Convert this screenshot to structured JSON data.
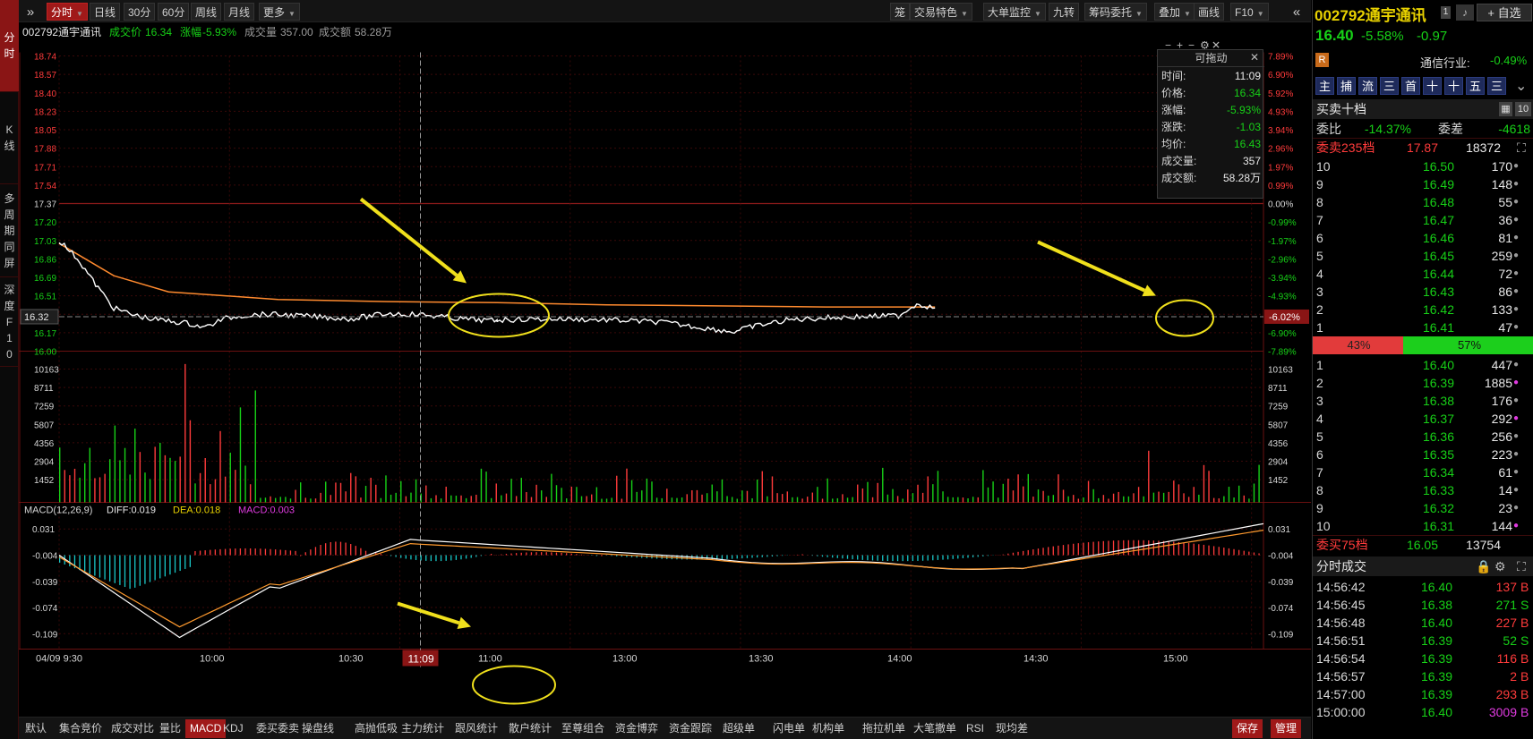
{
  "colors": {
    "up": "#ff3b3b",
    "down": "#17d117",
    "price_line": "#ffffff",
    "avg_line": "#ff8a2e",
    "accent": "#a01919",
    "annotation": "#f0e01c"
  },
  "left_tabs": [
    {
      "id": "fenshi",
      "chars": [
        "分",
        "时"
      ],
      "active": true
    },
    {
      "id": "kline",
      "chars": [
        "K",
        "线"
      ],
      "active": false
    },
    {
      "id": "multi",
      "chars": [
        "多",
        "周",
        "期",
        "同",
        "屏"
      ],
      "active": false
    },
    {
      "id": "depth",
      "chars": [
        "深",
        "度",
        "F",
        "1",
        "0"
      ],
      "active": false
    }
  ],
  "toolbar": {
    "expand_glyph": "»",
    "periods": [
      "分时",
      "日线",
      "30分",
      "60分",
      "周线",
      "月线"
    ],
    "more": "更多",
    "right": [
      "笼",
      "交易特色",
      "大单监控",
      "九转",
      "筹码委托",
      "叠加",
      "画线",
      "F10"
    ],
    "collapse_glyph": "«"
  },
  "info_bar": {
    "code_name": "002792通宇通讯",
    "price_label": "成交价",
    "price": "16.34",
    "change_label": "涨幅",
    "change": "-5.93%",
    "volume_label": "成交量",
    "volume": "357.00",
    "amount_label": "成交额",
    "amount": "58.28万"
  },
  "chart_icons": [
    "−",
    "+",
    "−",
    "⚙",
    "✕"
  ],
  "price_axis": {
    "left": [
      "18.74",
      "18.57",
      "18.40",
      "18.23",
      "18.05",
      "17.88",
      "17.71",
      "17.54",
      "17.37",
      "17.20",
      "17.03",
      "16.86",
      "16.69",
      "16.51",
      "16.34",
      "16.17",
      "16.00"
    ],
    "right": [
      "7.89%",
      "6.90%",
      "5.92%",
      "4.93%",
      "3.94%",
      "2.96%",
      "1.97%",
      "0.99%",
      "0.00%",
      "-0.99%",
      "-1.97%",
      "-2.96%",
      "-3.94%",
      "-4.93%",
      "-5.92%",
      "-6.90%",
      "-7.89%"
    ],
    "cursor_left": "16.32",
    "cursor_right": "-6.02%"
  },
  "volume_axis": [
    "10163",
    "8711",
    "7259",
    "5807",
    "4356",
    "2904",
    "1452"
  ],
  "tooltip": {
    "title": "可拖动",
    "close": "✕",
    "rows": [
      {
        "k": "时间:",
        "v": "11:09",
        "c": "white"
      },
      {
        "k": "价格:",
        "v": "16.34",
        "c": "green"
      },
      {
        "k": "涨幅:",
        "v": "-5.93%",
        "c": "green"
      },
      {
        "k": "涨跌:",
        "v": "-1.03",
        "c": "green"
      },
      {
        "k": "均价:",
        "v": "16.43",
        "c": "green"
      },
      {
        "k": "成交量:",
        "v": "357",
        "c": "white"
      },
      {
        "k": "成交额:",
        "v": "58.28万",
        "c": "white"
      }
    ]
  },
  "macd": {
    "label": "MACD(12,26,9)",
    "diff": "DIFF:0.019",
    "dea": "DEA:0.018",
    "macd": "MACD:0.003",
    "axis": [
      "0.031",
      "-0.004",
      "-0.039",
      "-0.074",
      "-0.109"
    ]
  },
  "time_axis": {
    "labels": [
      "04/09 9:30",
      "10:00",
      "10:30",
      "11:00",
      "13:00",
      "13:30",
      "14:00",
      "14:30",
      "15:00"
    ],
    "cursor": "11:09"
  },
  "bottom_tabs": [
    "默认",
    "集合竞价",
    "成交对比",
    "量比",
    "MACD",
    "KDJ",
    "委买委卖",
    "操盘线",
    "高抛低吸",
    "主力统计",
    "跟风统计",
    "散户统计",
    "至尊组合",
    "资金博弈",
    "资金跟踪",
    "超级单",
    "闪电单",
    "机构单",
    "拖拉机单",
    "大笔撤单",
    "RSI",
    "现均差"
  ],
  "bottom_right": [
    "保存",
    "管理"
  ],
  "right_panel": {
    "code": "002792",
    "name": "通宇通讯",
    "badge": "1",
    "self_select": "+ 自选",
    "price": "16.40",
    "pct": "-5.58%",
    "chg": "-0.97",
    "r_badge": "R",
    "industry": "通信行业:",
    "industry_pct": "-0.49%",
    "mini_buttons": [
      "主",
      "捕",
      "流",
      "三",
      "首",
      "十",
      "十",
      "五",
      "三"
    ],
    "book_title": "买卖十档",
    "book_size": "10",
    "ratio_label": "委比",
    "ratio": "-14.37%",
    "diff_label": "委差",
    "diff": "-4618",
    "ask_header": {
      "label": "委卖235档",
      "price": "17.87",
      "vol": "18372"
    },
    "asks": [
      {
        "n": "10",
        "p": "16.50",
        "v": "170"
      },
      {
        "n": "9",
        "p": "16.49",
        "v": "148"
      },
      {
        "n": "8",
        "p": "16.48",
        "v": "55"
      },
      {
        "n": "7",
        "p": "16.47",
        "v": "36"
      },
      {
        "n": "6",
        "p": "16.46",
        "v": "81"
      },
      {
        "n": "5",
        "p": "16.45",
        "v": "259"
      },
      {
        "n": "4",
        "p": "16.44",
        "v": "72"
      },
      {
        "n": "3",
        "p": "16.43",
        "v": "86"
      },
      {
        "n": "2",
        "p": "16.42",
        "v": "133"
      },
      {
        "n": "1",
        "p": "16.41",
        "v": "47"
      }
    ],
    "split": {
      "sell": "43%",
      "buy": "57%",
      "sell_frac": 0.43
    },
    "bids": [
      {
        "n": "1",
        "p": "16.40",
        "v": "447",
        "dot": "gray"
      },
      {
        "n": "2",
        "p": "16.39",
        "v": "1885",
        "dot": "magenta"
      },
      {
        "n": "3",
        "p": "16.38",
        "v": "176",
        "dot": "gray"
      },
      {
        "n": "4",
        "p": "16.37",
        "v": "292",
        "dot": "magenta"
      },
      {
        "n": "5",
        "p": "16.36",
        "v": "256",
        "dot": "gray"
      },
      {
        "n": "6",
        "p": "16.35",
        "v": "223",
        "dot": "gray"
      },
      {
        "n": "7",
        "p": "16.34",
        "v": "61",
        "dot": "gray"
      },
      {
        "n": "8",
        "p": "16.33",
        "v": "14",
        "dot": "gray"
      },
      {
        "n": "9",
        "p": "16.32",
        "v": "23",
        "dot": "gray"
      },
      {
        "n": "10",
        "p": "16.31",
        "v": "144",
        "dot": "magenta"
      }
    ],
    "bid_header": {
      "label": "委买75档",
      "price": "16.05",
      "vol": "13754"
    },
    "trades_title": "分时成交",
    "trades": [
      {
        "t": "14:56:42",
        "p": "16.40",
        "v": "137",
        "s": "B",
        "c": "red"
      },
      {
        "t": "14:56:45",
        "p": "16.38",
        "v": "271",
        "s": "S",
        "c": "green"
      },
      {
        "t": "14:56:48",
        "p": "16.40",
        "v": "227",
        "s": "B",
        "c": "red"
      },
      {
        "t": "14:56:51",
        "p": "16.39",
        "v": "52",
        "s": "S",
        "c": "green"
      },
      {
        "t": "14:56:54",
        "p": "16.39",
        "v": "116",
        "s": "B",
        "c": "red"
      },
      {
        "t": "14:56:57",
        "p": "16.39",
        "v": "2",
        "s": "B",
        "c": "red"
      },
      {
        "t": "14:57:00",
        "p": "16.39",
        "v": "293",
        "s": "B",
        "c": "red"
      },
      {
        "t": "15:00:00",
        "p": "16.40",
        "v": "3009",
        "s": "B",
        "c": "magenta"
      }
    ]
  },
  "annotations": [
    {
      "type": "arrow",
      "name": "arrow-1"
    },
    {
      "type": "arrow",
      "name": "arrow-2"
    },
    {
      "type": "arrow",
      "name": "arrow-3"
    },
    {
      "type": "ellipse",
      "name": "circle-1"
    },
    {
      "type": "ellipse",
      "name": "circle-2"
    },
    {
      "type": "ellipse",
      "name": "circle-3"
    }
  ],
  "chart_data": {
    "type": "line",
    "x_range": [
      "09:30",
      "15:00"
    ],
    "ylim": [
      16.0,
      18.74
    ],
    "prev_close": 17.37,
    "series": [
      {
        "name": "price",
        "x": [
          "09:30",
          "09:35",
          "09:40",
          "09:45",
          "09:50",
          "09:55",
          "10:00",
          "10:05",
          "10:10",
          "10:15",
          "10:20",
          "10:25",
          "10:30",
          "10:40",
          "10:50",
          "11:00",
          "11:09",
          "11:20",
          "11:30",
          "13:00",
          "13:15",
          "13:30",
          "13:45",
          "14:00",
          "14:05",
          "14:10",
          "14:20",
          "14:30",
          "14:40",
          "14:50",
          "14:55",
          "15:00"
        ],
        "values": [
          17.03,
          16.86,
          16.62,
          16.4,
          16.34,
          16.3,
          16.28,
          16.26,
          16.22,
          16.3,
          16.33,
          16.34,
          16.34,
          16.32,
          16.3,
          16.35,
          16.34,
          16.3,
          16.28,
          16.29,
          16.3,
          16.29,
          16.27,
          16.2,
          16.18,
          16.23,
          16.29,
          16.31,
          16.32,
          16.33,
          16.44,
          16.4
        ]
      },
      {
        "name": "avg",
        "x": [
          "09:30",
          "09:45",
          "10:00",
          "10:30",
          "11:00",
          "11:30",
          "13:30",
          "14:00",
          "14:30",
          "15:00"
        ],
        "values": [
          17.0,
          16.7,
          16.55,
          16.48,
          16.46,
          16.45,
          16.43,
          16.42,
          16.41,
          16.41
        ]
      }
    ],
    "macd": {
      "diff": 0.019,
      "dea": 0.018,
      "macd": 0.003,
      "ylim": [
        -0.12,
        0.045
      ]
    }
  }
}
